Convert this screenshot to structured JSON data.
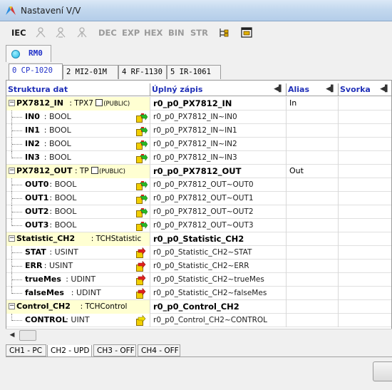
{
  "window": {
    "title": "Nastavení V/V"
  },
  "toolbar": {
    "iec": "IEC",
    "dec": "DEC",
    "exp": "EXP",
    "hex": "HEX",
    "bin": "BIN",
    "str": "STR"
  },
  "interface_tab": {
    "label": "RM0"
  },
  "module_tabs": [
    "0 CP-1020",
    "2 MI2-01M",
    "4 RF-1130",
    "5 IR-1061"
  ],
  "grid": {
    "columns": [
      "Struktura dat",
      "Úplný zápis",
      "Alias",
      "Svorka"
    ],
    "groups": [
      {
        "name": "PX7812_IN",
        "type": ": TPX7",
        "public": "(PUBLIC)",
        "full": "r0_p0_PX7812_IN",
        "alias": "In",
        "children": [
          {
            "name": "IN0",
            "type": ": BOOL",
            "full": "r0_p0_PX7812_IN~IN0",
            "pin": "green-arrow"
          },
          {
            "name": "IN1",
            "type": ": BOOL",
            "full": "r0_p0_PX7812_IN~IN1",
            "pin": "green-arrow"
          },
          {
            "name": "IN2",
            "type": ": BOOL",
            "full": "r0_p0_PX7812_IN~IN2",
            "pin": "green-arrow"
          },
          {
            "name": "IN3",
            "type": ": BOOL",
            "full": "r0_p0_PX7812_IN~IN3",
            "pin": "green-arrow"
          }
        ]
      },
      {
        "name": "PX7812_OUT",
        "type": ": TP",
        "public": "(PUBLIC)",
        "full": "r0_p0_PX7812_OUT",
        "alias": "Out",
        "children": [
          {
            "name": "OUT0",
            "type": ": BOOL",
            "full": "r0_p0_PX7812_OUT~OUT0",
            "pin": "green-arrow"
          },
          {
            "name": "OUT1",
            "type": ": BOOL",
            "full": "r0_p0_PX7812_OUT~OUT1",
            "pin": "green-arrow"
          },
          {
            "name": "OUT2",
            "type": ": BOOL",
            "full": "r0_p0_PX7812_OUT~OUT2",
            "pin": "green-arrow"
          },
          {
            "name": "OUT3",
            "type": ": BOOL",
            "full": "r0_p0_PX7812_OUT~OUT3",
            "pin": "green-arrow"
          }
        ]
      },
      {
        "name": "Statistic_CH2",
        "type": ": TCHStatistic",
        "public": "",
        "full": "r0_p0_Statistic_CH2",
        "alias": "",
        "children": [
          {
            "name": "STAT",
            "type": ": USINT",
            "full": "r0_p0_Statistic_CH2~STAT",
            "pin": "red-arrow"
          },
          {
            "name": "ERR",
            "type": ": USINT",
            "full": "r0_p0_Statistic_CH2~ERR",
            "pin": "red-arrow"
          },
          {
            "name": "trueMes",
            "type": ": UDINT",
            "full": "r0_p0_Statistic_CH2~trueMes",
            "pin": "red-arrow"
          },
          {
            "name": "falseMes",
            "type": ": UDINT",
            "full": "r0_p0_Statistic_CH2~falseMes",
            "pin": "red-arrow"
          }
        ]
      },
      {
        "name": "Control_CH2",
        "type": ": TCHControl",
        "public": "",
        "full": "r0_p0_Control_CH2",
        "alias": "",
        "children": [
          {
            "name": "CONTROL",
            "type": ": UINT",
            "full": "r0_p0_Control_CH2~CONTROL",
            "pin": "yellow-arrow"
          }
        ]
      }
    ]
  },
  "channel_tabs": [
    "CH1 - PC",
    "CH2 - UPD",
    "CH3 - OFF",
    "CH4 - OFF"
  ],
  "colors": {
    "accent": "#2030c8",
    "group_bg": "#ffffd2",
    "header_text": "#2030b8"
  }
}
